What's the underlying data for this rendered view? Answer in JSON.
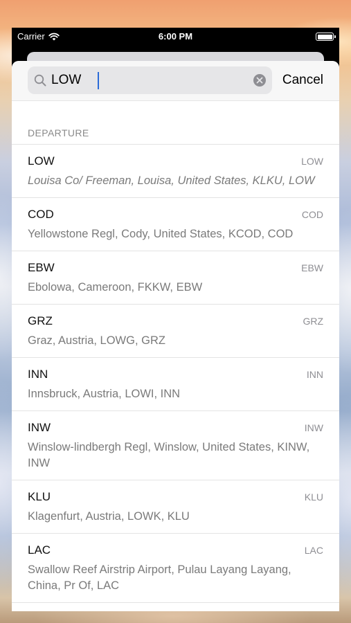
{
  "status_bar": {
    "carrier": "Carrier",
    "time": "6:00 PM"
  },
  "search": {
    "value": "LOW",
    "cancel_label": "Cancel"
  },
  "section": {
    "title": "DEPARTURE"
  },
  "results": [
    {
      "code": "LOW",
      "badge": "LOW",
      "detail": "Louisa Co/ Freeman, Louisa, United States, KLKU, LOW",
      "italic": true
    },
    {
      "code": "COD",
      "badge": "COD",
      "detail": "Yellowstone Regl, Cody, United States, KCOD, COD"
    },
    {
      "code": "EBW",
      "badge": "EBW",
      "detail": "Ebolowa, Cameroon, FKKW, EBW"
    },
    {
      "code": "GRZ",
      "badge": "GRZ",
      "detail": "Graz, Austria, LOWG, GRZ"
    },
    {
      "code": "INN",
      "badge": "INN",
      "detail": "Innsbruck, Austria, LOWI, INN"
    },
    {
      "code": "INW",
      "badge": "INW",
      "detail": "Winslow-lindbergh Regl, Winslow, United States, KINW, INW"
    },
    {
      "code": "KLU",
      "badge": "KLU",
      "detail": "Klagenfurt, Austria, LOWK, KLU"
    },
    {
      "code": "LAC",
      "badge": "LAC",
      "detail": "Swallow Reef Airstrip Airport, Pulau Layang  Layang, China, Pr Of, LAC"
    }
  ]
}
